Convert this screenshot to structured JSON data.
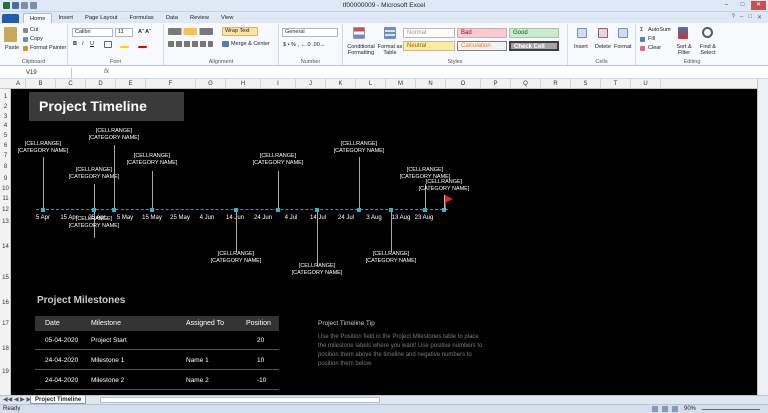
{
  "window": {
    "title": "tf00000009 - Microsoft Excel"
  },
  "ribbon_tabs": [
    "Home",
    "Insert",
    "Page Layout",
    "Formulas",
    "Data",
    "Review",
    "View"
  ],
  "clipboard": {
    "paste": "Paste",
    "cut": "Cut",
    "copy": "Copy",
    "format_painter": "Format Painter",
    "label": "Clipboard"
  },
  "font": {
    "name": "Calibri",
    "size": "11",
    "label": "Font"
  },
  "alignment": {
    "wrap": "Wrap Text",
    "merge": "Merge & Center",
    "label": "Alignment"
  },
  "number": {
    "format": "General",
    "label": "Number"
  },
  "styles": {
    "conditional": "Conditional Formatting",
    "format_table": "Format as Table",
    "normal": "Normal",
    "bad": "Bad",
    "good": "Good",
    "neutral": "Neutral",
    "calculation": "Calculation",
    "check_cell": "Check Cell",
    "label": "Styles"
  },
  "cells": {
    "insert": "Insert",
    "delete": "Delete",
    "format": "Format",
    "label": "Cells"
  },
  "editing": {
    "autosum": "AutoSum",
    "fill": "Fill",
    "clear": "Clear",
    "sort": "Sort & Filter",
    "find": "Find & Select",
    "label": "Editing"
  },
  "formula_bar": {
    "cell": "V19",
    "fx": "fx",
    "value": ""
  },
  "columns": [
    "A",
    "B",
    "C",
    "D",
    "E",
    "F",
    "G",
    "H",
    "I",
    "J",
    "K",
    "L",
    "M",
    "N",
    "O",
    "P",
    "Q",
    "R",
    "S",
    "T",
    "U"
  ],
  "rows": [
    "1",
    "2",
    "3",
    "4",
    "5",
    "6",
    "7",
    "8",
    "9",
    "10",
    "11",
    "12",
    "13",
    "14",
    "15",
    "16",
    "17",
    "18",
    "19"
  ],
  "sheet": {
    "title": "Project Timeline",
    "ticks": [
      "5 Apr",
      "15 Apr",
      "25 Apr",
      "5 May",
      "15 May",
      "25 May",
      "4 Jun",
      "14 Jun",
      "24 Jun",
      "4 Jul",
      "14 Jul",
      "24 Jul",
      "3 Aug",
      "13 Aug",
      "23 Aug"
    ],
    "label_line1": "[CELLRANGE]",
    "label_line2": "[CATEGORY NAME]",
    "milestones_title": "Project Milestones",
    "table_headers": [
      "Date",
      "Milestone",
      "Assigned To",
      "Position"
    ],
    "table_rows": [
      {
        "date": "05-04-2020",
        "milestone": "Project Start",
        "assigned": "",
        "position": "20"
      },
      {
        "date": "24-04-2020",
        "milestone": "Milestone 1",
        "assigned": "Name 1",
        "position": "10"
      },
      {
        "date": "24-04-2020",
        "milestone": "Milestone 2",
        "assigned": "Name 2",
        "position": "-10"
      }
    ],
    "tip_title": "Project Timeline Tip",
    "tip_body": "Use the Position field in the Project Milestones table to place the milestone labels where you want! Use positive numbers to position them above the timeline and negative numbers to position them below."
  },
  "sheet_tab": "Project Timeline",
  "status": {
    "text": "Ready",
    "zoom": "90%"
  },
  "colors": {
    "sheet_bg": "#000000",
    "accent": "#31b5cf",
    "flag": "#e02020"
  }
}
